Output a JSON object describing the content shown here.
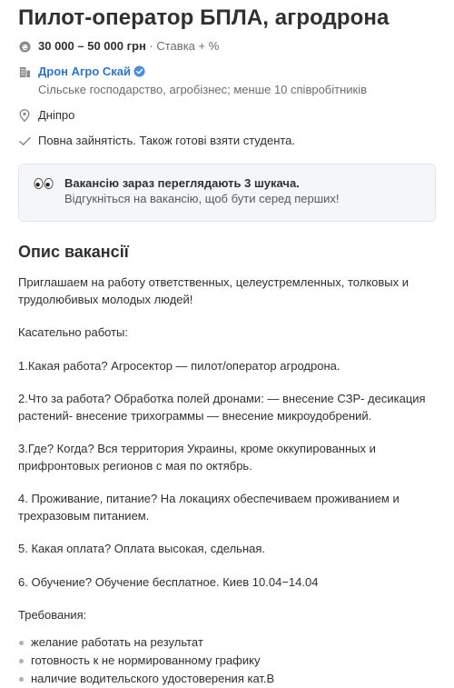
{
  "job": {
    "title": "Пилот-оператор БПЛА, агродрона",
    "salary": "30 000 – 50 000 грн",
    "salary_note": "· Ставка + %",
    "company_name": "Дрон Агро Скай",
    "company_details": "Сільське господарство, агробізнес; менше 10 співробітників",
    "location": "Дніпро",
    "employment": "Повна зайнятість. Також готові взяти студента."
  },
  "alert": {
    "title": "Вакансію зараз переглядають 3 шукача.",
    "subtitle": "Відгукніться на вакансію, щоб бути серед перших!"
  },
  "description": {
    "heading": "Опис вакансії",
    "paragraphs": [
      "Приглашаем на работу ответственных, целеустремленных, толковых и трудолюбивых молодых людей!",
      "Касательно работы:",
      "1.Какая работа? Агросектор — пилот/оператор агродрона.",
      "2.Что за работа? Обработка полей дронами: — внесение СЗР- десикация растений- внесение трихограммы — внесение микроудобрений.",
      "3.Где? Когда? Вся территория Украины, кроме оккупированных и прифронтовых регионов с мая по октябрь.",
      "4. Проживание, питание? На локациях обеспечиваем проживанием и трехразовым питанием.",
      "5. Какая оплата? Оплата высокая, сдельная.",
      "6. Обучение? Обучение бесплатное. Киев 10.04−14.04",
      "Требования:"
    ],
    "requirements": [
      "желание работать на результат",
      "готовность к не нормированному графику",
      "наличие водительского удостоверения кат.В"
    ]
  },
  "colors": {
    "link": "#2e74cc",
    "verified": "#4a90e2",
    "icon": "#8a8a8a"
  },
  "icons": [
    "salary-icon",
    "company-icon",
    "verified-icon",
    "location-icon",
    "check-icon",
    "eyes-icon"
  ]
}
